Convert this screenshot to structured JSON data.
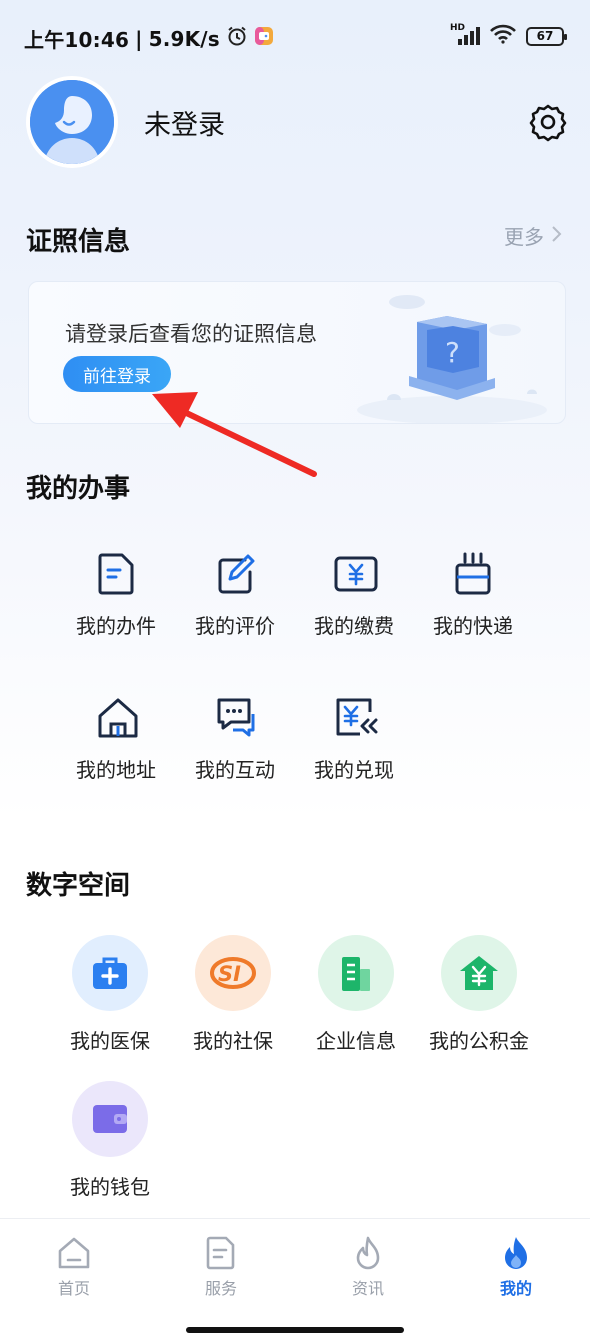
{
  "status_bar": {
    "time": "上午10:46",
    "speed": "5.9K/s",
    "network": "HD",
    "battery": "67"
  },
  "profile": {
    "name": "未登录"
  },
  "certificates": {
    "title": "证照信息",
    "more_label": "更多",
    "prompt": "请登录后查看您的证照信息",
    "login_button": "前往登录"
  },
  "my_affairs": {
    "title": "我的办事",
    "items": [
      {
        "label": "我的办件",
        "icon": "document-icon"
      },
      {
        "label": "我的评价",
        "icon": "edit-icon"
      },
      {
        "label": "我的缴费",
        "icon": "yuan-card-icon"
      },
      {
        "label": "我的快递",
        "icon": "package-icon"
      },
      {
        "label": "我的地址",
        "icon": "house-icon"
      },
      {
        "label": "我的互动",
        "icon": "chat-icon"
      },
      {
        "label": "我的兑现",
        "icon": "yuan-return-icon"
      }
    ]
  },
  "digital_space": {
    "title": "数字空间",
    "items": [
      {
        "label": "我的医保",
        "icon": "medical-kit-icon"
      },
      {
        "label": "我的社保",
        "icon": "social-security-icon"
      },
      {
        "label": "企业信息",
        "icon": "building-icon"
      },
      {
        "label": "我的公积金",
        "icon": "house-yuan-icon"
      },
      {
        "label": "我的钱包",
        "icon": "wallet-icon"
      }
    ]
  },
  "tabbar": {
    "items": [
      {
        "label": "首页",
        "icon": "home-tab-icon",
        "active": false
      },
      {
        "label": "服务",
        "icon": "service-tab-icon",
        "active": false
      },
      {
        "label": "资讯",
        "icon": "flame-outline-icon",
        "active": false
      },
      {
        "label": "我的",
        "icon": "flame-filled-icon",
        "active": true
      }
    ]
  },
  "colors": {
    "accent": "#1f6fe5",
    "login_button": "#2f8ef3",
    "annotation_arrow": "#ee2a24"
  }
}
